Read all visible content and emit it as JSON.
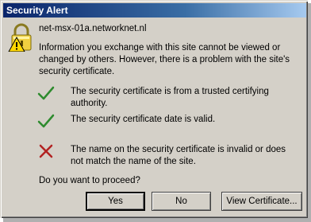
{
  "window": {
    "title": "Security Alert"
  },
  "host": "net-msx-01a.networknet.nl",
  "info": "Information you exchange with this site cannot be viewed or changed by others. However, there is a problem with the site's security certificate.",
  "checks": [
    {
      "status": "ok",
      "icon": "check-icon",
      "text": "The security certificate is from a trusted certifying authority."
    },
    {
      "status": "ok",
      "icon": "check-icon",
      "text": "The security certificate date is valid."
    },
    {
      "status": "error",
      "icon": "x-icon",
      "text": "The name on the security certificate is invalid or does not match the name of the site."
    }
  ],
  "question": "Do you want to proceed?",
  "buttons": {
    "yes": "Yes",
    "no": "No",
    "view": "View Certificate..."
  },
  "colors": {
    "ok": "#2e8b2e",
    "error": "#b22222",
    "titlebar": "#0a246a"
  }
}
